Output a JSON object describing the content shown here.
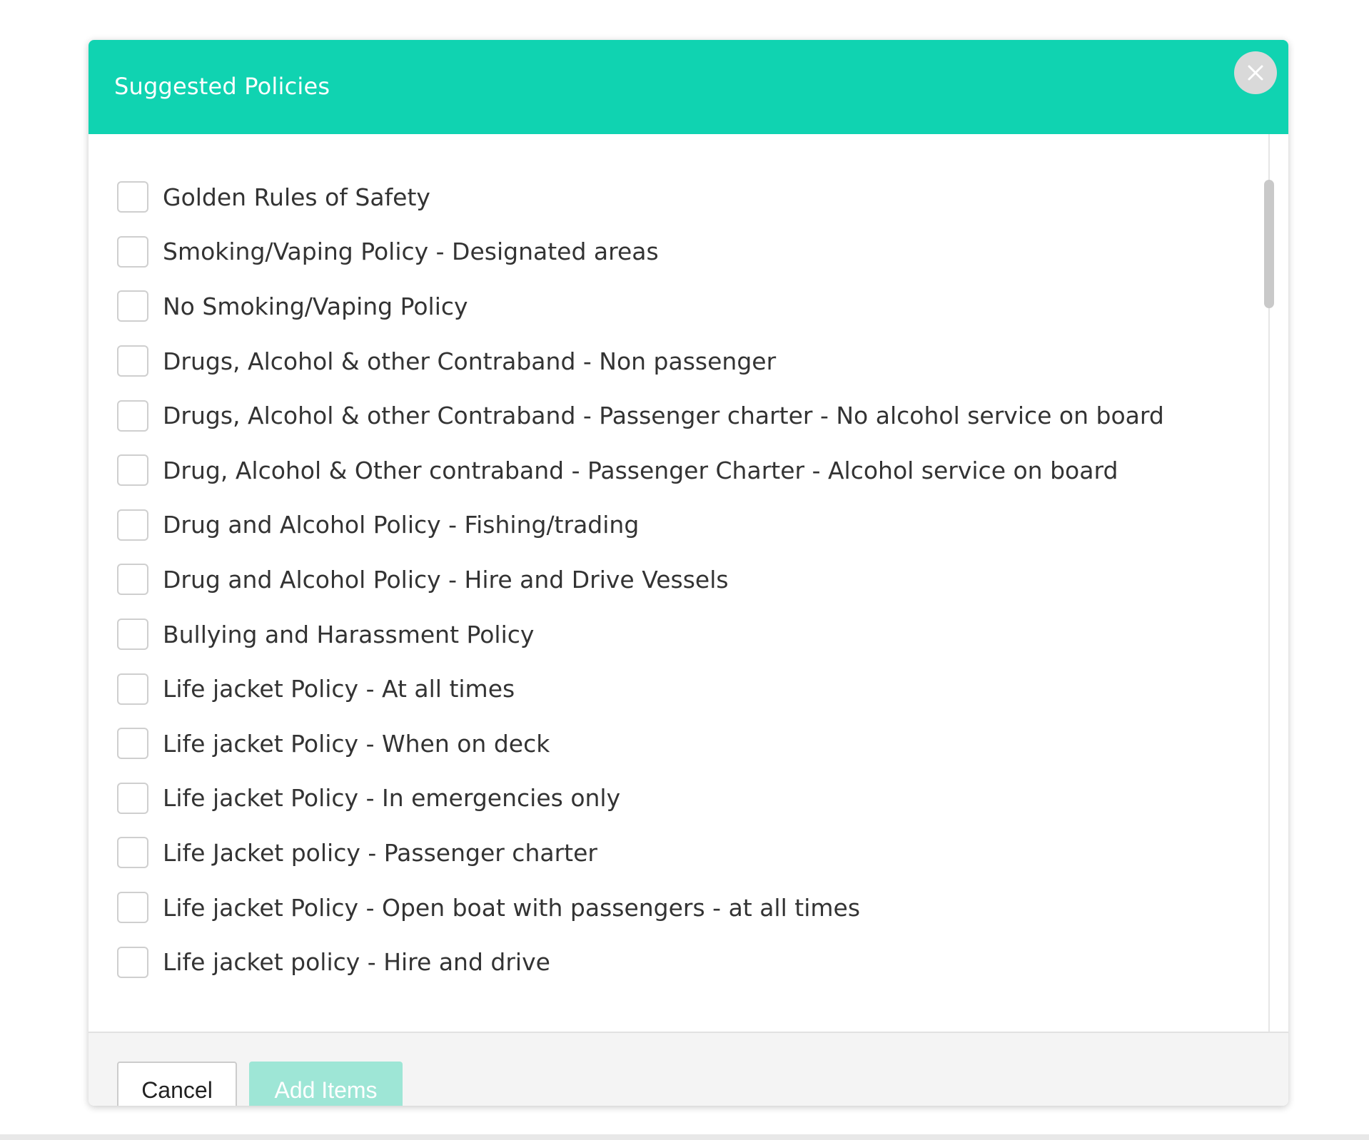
{
  "dialog": {
    "title": "Suggested Policies",
    "close_icon": "close-icon"
  },
  "policies": [
    {
      "label": "Golden Rules of Safety",
      "checked": false
    },
    {
      "label": "Smoking/Vaping Policy - Designated areas",
      "checked": false
    },
    {
      "label": "No Smoking/Vaping Policy",
      "checked": false
    },
    {
      "label": "Drugs, Alcohol & other Contraband - Non passenger",
      "checked": false
    },
    {
      "label": "Drugs, Alcohol & other Contraband - Passenger charter - No alcohol service on board",
      "checked": false
    },
    {
      "label": "Drug, Alcohol & Other contraband - Passenger Charter - Alcohol service on board",
      "checked": false
    },
    {
      "label": "Drug and Alcohol Policy - Fishing/trading",
      "checked": false
    },
    {
      "label": "Drug and Alcohol Policy - Hire and Drive Vessels",
      "checked": false
    },
    {
      "label": "Bullying and Harassment Policy",
      "checked": false
    },
    {
      "label": "Life jacket Policy - At all times",
      "checked": false
    },
    {
      "label": "Life jacket Policy - When on deck",
      "checked": false
    },
    {
      "label": "Life jacket Policy - In emergencies only",
      "checked": false
    },
    {
      "label": "Life Jacket policy - Passenger charter",
      "checked": false
    },
    {
      "label": "Life jacket Policy - Open boat with passengers - at all times",
      "checked": false
    },
    {
      "label": "Life jacket policy - Hire and drive",
      "checked": false
    }
  ],
  "footer": {
    "cancel_label": "Cancel",
    "add_label": "Add Items",
    "add_disabled": true
  },
  "colors": {
    "header": "#10d3b1",
    "add_button_disabled": "#9ee6d6"
  }
}
